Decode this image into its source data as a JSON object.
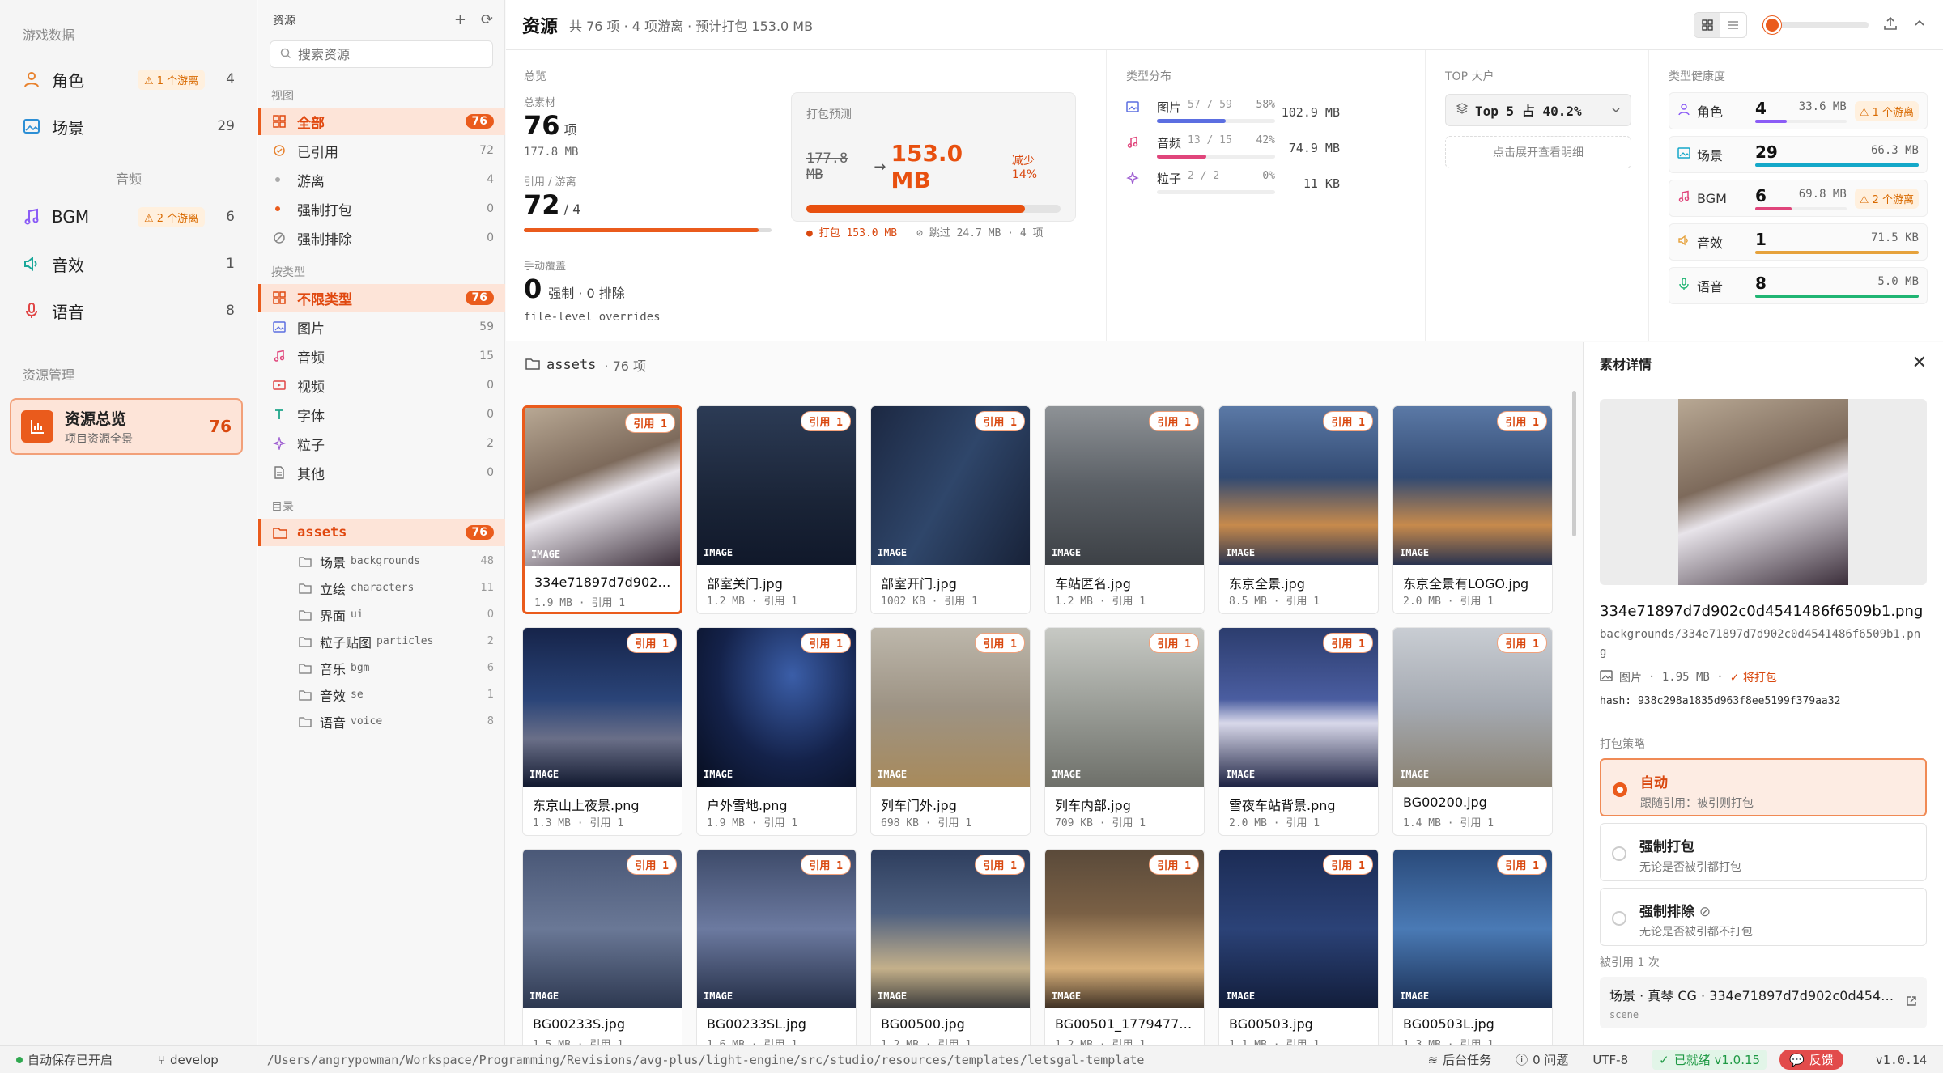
{
  "left_nav": {
    "section_game_data": "游戏数据",
    "items_top": [
      {
        "label": "角色",
        "count": "4",
        "badge": "⚠ 1 个游离"
      },
      {
        "label": "场景",
        "count": "29"
      }
    ],
    "section_audio": "音频",
    "items_audio": [
      {
        "label": "BGM",
        "count": "6",
        "badge": "⚠ 2 个游离"
      },
      {
        "label": "音效",
        "count": "1"
      },
      {
        "label": "语音",
        "count": "8"
      }
    ],
    "section_manage": "资源管理",
    "overview": {
      "title": "资源总览",
      "subtitle": "项目资源全景",
      "count": "76"
    }
  },
  "tree": {
    "header": "资源",
    "search_placeholder": "搜索资源",
    "group_view": "视图",
    "view_items": [
      {
        "label": "全部",
        "count": "76"
      },
      {
        "label": "已引用",
        "count": "72"
      },
      {
        "label": "游离",
        "count": "4"
      },
      {
        "label": "强制打包",
        "count": "0"
      },
      {
        "label": "强制排除",
        "count": "0"
      }
    ],
    "group_type": "按类型",
    "type_items": [
      {
        "label": "不限类型",
        "count": "76"
      },
      {
        "label": "图片",
        "count": "59"
      },
      {
        "label": "音频",
        "count": "15"
      },
      {
        "label": "视频",
        "count": "0"
      },
      {
        "label": "字体",
        "count": "0"
      },
      {
        "label": "粒子",
        "count": "2"
      },
      {
        "label": "其他",
        "count": "0"
      }
    ],
    "group_dir": "目录",
    "root": {
      "label": "assets",
      "count": "76"
    },
    "dirs": [
      {
        "label": "场景",
        "sub": "backgrounds",
        "count": "48"
      },
      {
        "label": "立绘",
        "sub": "characters",
        "count": "11"
      },
      {
        "label": "界面",
        "sub": "ui",
        "count": "0"
      },
      {
        "label": "粒子贴图",
        "sub": "particles",
        "count": "2"
      },
      {
        "label": "音乐",
        "sub": "bgm",
        "count": "6"
      },
      {
        "label": "音效",
        "sub": "se",
        "count": "1"
      },
      {
        "label": "语音",
        "sub": "voice",
        "count": "8"
      }
    ]
  },
  "header": {
    "title": "资源",
    "summary": "共 76 项 · 4 项游离 · 预计打包 153.0 MB",
    "zoom": 0.1
  },
  "dash": {
    "overview_label": "总览",
    "total_label": "总素材",
    "total_value": "76",
    "total_unit": "项",
    "total_size": "177.8 MB",
    "ref_label": "引用 / 游离",
    "ref_value": "72",
    "ref_sub": "/ 4",
    "ref_ratio": 0.947,
    "pack_label": "打包预测",
    "pack_old": "177.8 MB",
    "pack_arrow": "→",
    "pack_new": "153.0 MB",
    "pack_reduce": "减少 14%",
    "pack_ratio": 0.86,
    "pack_included": "● 打包 153.0 MB",
    "pack_skipped": "⊘ 跳过 24.7 MB · 4 项",
    "override_label": "手动覆盖",
    "override_value": "0",
    "override_text": "强制 · 0 排除",
    "override_note": "file-level overrides",
    "types_title": "类型分布",
    "types": [
      {
        "name": "图片",
        "frac": "57 / 59",
        "pct": "58%",
        "size": "102.9 MB",
        "ratio": 0.58,
        "color": "#5b6ee1"
      },
      {
        "name": "音频",
        "frac": "13 / 15",
        "pct": "42%",
        "size": "74.9 MB",
        "ratio": 0.42,
        "color": "#e0457b"
      },
      {
        "name": "粒子",
        "frac": "2 / 2",
        "pct": "0%",
        "size": "11 KB",
        "ratio": 0.0,
        "color": "#9b59d0"
      }
    ],
    "top_title": "TOP 大户",
    "top_select": "Top 5 占 40.2%",
    "top_expand": "点击展开查看明细",
    "health_title": "类型健康度",
    "health": [
      {
        "name": "角色",
        "num": "4",
        "size": "33.6 MB",
        "badge": "⚠ 1 个游离",
        "color": "#8b5cf6",
        "ratio": 0.35
      },
      {
        "name": "场景",
        "num": "29",
        "size": "66.3 MB",
        "badge": "",
        "color": "#14a8c9",
        "ratio": 1.0
      },
      {
        "name": "BGM",
        "num": "6",
        "size": "69.8 MB",
        "badge": "⚠ 2 个游离",
        "color": "#e0457b",
        "ratio": 0.4
      },
      {
        "name": "音效",
        "num": "1",
        "size": "71.5 KB",
        "badge": "",
        "color": "#e6a23c",
        "ratio": 1.0
      },
      {
        "name": "语音",
        "num": "8",
        "size": "5.0 MB",
        "badge": "",
        "color": "#20b573",
        "ratio": 1.0
      }
    ]
  },
  "grid": {
    "folder": "assets",
    "count": "· 76 项",
    "ref_badge": "引用 1",
    "kind_label": "IMAGE",
    "cards": [
      {
        "name": "334e71897d7d902c...",
        "meta": "1.9 MB · 引用 1",
        "bg": "linear-gradient(160deg,#b8a894 0%,#7d6a5b 40%,#e8e4ea 55%,#3b2e3a 100%)"
      },
      {
        "name": "部室关门.jpg",
        "meta": "1.2 MB · 引用 1",
        "bg": "linear-gradient(180deg,#2c3b55 0%,#1a2437 60%,#10182a 100%)"
      },
      {
        "name": "部室开门.jpg",
        "meta": "1002 KB · 引用 1",
        "bg": "linear-gradient(120deg,#1c2842 0%,#2f466a 50%,#182238 100%)"
      },
      {
        "name": "车站匿名.jpg",
        "meta": "1.2 MB · 引用 1",
        "bg": "linear-gradient(180deg,#8e9296 0%,#5b6066 50%,#3d4146 100%)"
      },
      {
        "name": "东京全景.jpg",
        "meta": "8.5 MB · 引用 1",
        "bg": "linear-gradient(180deg,#5b79a6 0%,#324a72 45%,#c78a4c 75%,#2a3450 100%)"
      },
      {
        "name": "东京全景有LOGO.jpg",
        "meta": "2.0 MB · 引用 1",
        "bg": "linear-gradient(180deg,#5b79a6 0%,#324a72 45%,#c78a4c 75%,#2a3450 100%)"
      },
      {
        "name": "东京山上夜景.png",
        "meta": "1.3 MB · 引用 1",
        "bg": "linear-gradient(180deg,#16244a 0%,#2a4478 45%,#6a6f88 70%,#121a30 100%)"
      },
      {
        "name": "户外雪地.png",
        "meta": "1.9 MB · 引用 1",
        "bg": "radial-gradient(ellipse at 60% 30%,#3b5ea8 0%,#14224a 55%,#070d1e 100%)"
      },
      {
        "name": "列车门外.jpg",
        "meta": "698 KB · 引用 1",
        "bg": "linear-gradient(180deg,#bdb7ab 0%,#9d9384 50%,#a88a5b 100%)"
      },
      {
        "name": "列车内部.jpg",
        "meta": "709 KB · 引用 1",
        "bg": "linear-gradient(180deg,#c7c9c4 0%,#9a9d97 50%,#6e706a 100%)"
      },
      {
        "name": "雪夜车站背景.png",
        "meta": "2.0 MB · 引用 1",
        "bg": "linear-gradient(180deg,#2c3d6e 0%,#4a5da0 45%,#d8d8ea 60%,#1f2444 100%)"
      },
      {
        "name": "BG00200.jpg",
        "meta": "1.4 MB · 引用 1",
        "bg": "linear-gradient(180deg,#c9cdd3 0%,#a4a9b1 50%,#8a8170 100%)"
      },
      {
        "name": "BG00233S.jpg",
        "meta": "1.5 MB · 引用 1",
        "bg": "linear-gradient(180deg,#4a5877 0%,#6a7896 50%,#2d3850 100%)"
      },
      {
        "name": "BG00233SL.jpg",
        "meta": "1.6 MB · 引用 1",
        "bg": "linear-gradient(180deg,#3e4b6a 0%,#6c7aa0 50%,#232d45 100%)"
      },
      {
        "name": "BG00500.jpg",
        "meta": "1.2 MB · 引用 1",
        "bg": "linear-gradient(180deg,#2e3e5e 0%,#4e6080 40%,#c4b08a 75%,#3a3a3a 100%)"
      },
      {
        "name": "BG00501_17794778...",
        "meta": "1.2 MB · 引用 1",
        "bg": "linear-gradient(180deg,#5a4a3a 0%,#7a6045 40%,#d8b07a 75%,#3e3024 100%)"
      },
      {
        "name": "BG00503.jpg",
        "meta": "1.1 MB · 引用 1",
        "bg": "linear-gradient(180deg,#1c2c55 0%,#2b4277 50%,#121d3a 100%)"
      },
      {
        "name": "BG00503L.jpg",
        "meta": "1.3 MB · 引用 1",
        "bg": "linear-gradient(180deg,#2a4a7a 0%,#4a7ab5 50%,#1a2e52 100%)"
      }
    ]
  },
  "detail": {
    "title": "素材详情",
    "file_name": "334e71897d7d902c0d4541486f6509b1.png",
    "path": "backgrounds/334e71897d7d902c0d4541486f6509b1.png",
    "type": "图片",
    "size": "· 1.95 MB ·",
    "pack_state": "✓ 将打包",
    "hash": "hash: 938c298a1835d963f8ee5199f379aa32",
    "policy_label": "打包策略",
    "options": [
      {
        "title": "自动",
        "desc": "跟随引用：被引则打包"
      },
      {
        "title": "强制打包",
        "desc": "无论是否被引都打包"
      },
      {
        "title": "强制排除",
        "desc": "无论是否被引都不打包"
      }
    ],
    "ref_label": "被引用 1 次",
    "ref_title": "场景 · 真琴 CG · 334e71897d7d902c0d45414...",
    "ref_sub": "scene"
  },
  "status": {
    "autosave": "自动保存已开启",
    "branch": "develop",
    "path": "/Users/angrypowman/Workspace/Programming/Revisions/avg-plus/light-engine/src/studio/resources/templates/letsgal-template",
    "tasks": "后台任务",
    "problems": "0 问题",
    "encoding": "UTF-8",
    "ready": "已就绪 v1.0.15",
    "feedback": "反馈",
    "version": "v1.0.14"
  },
  "colors": {
    "accent": "#ea5b1c",
    "accent_light": "#fde4d8"
  }
}
